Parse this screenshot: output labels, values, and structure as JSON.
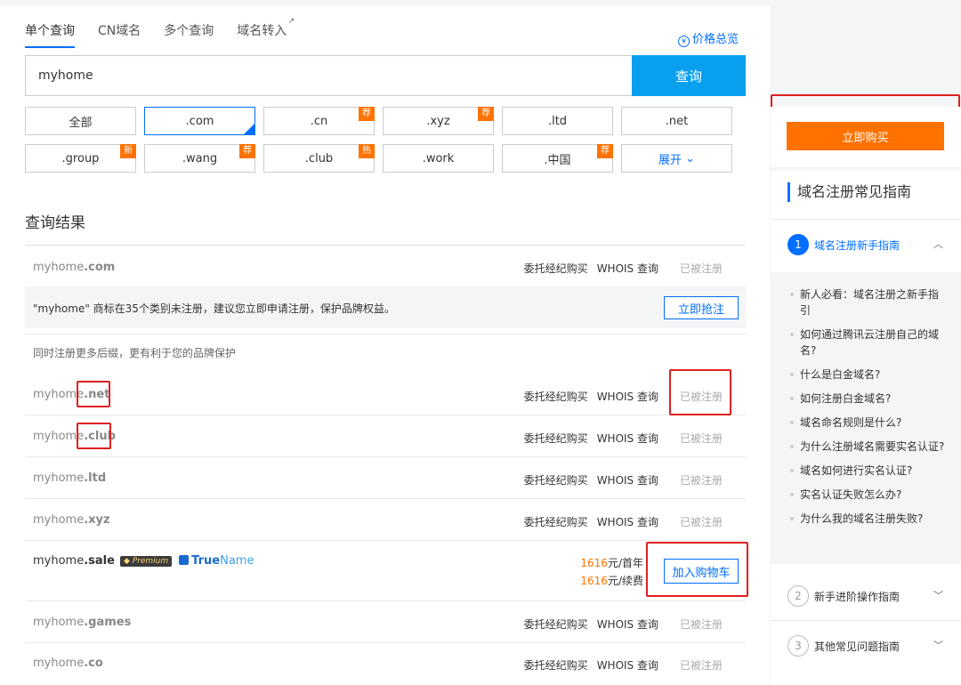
{
  "tabs": [
    {
      "label": "单个查询",
      "active": true
    },
    {
      "label": "CN域名",
      "active": false
    },
    {
      "label": "多个查询",
      "active": false
    },
    {
      "label": "域名转入",
      "active": false
    }
  ],
  "price_overview": "价格总览",
  "search": {
    "value": "myhome",
    "button": "查询"
  },
  "tlds": [
    {
      "label": "全部",
      "badge": ""
    },
    {
      "label": ".com",
      "badge": ""
    },
    {
      "label": ".cn",
      "badge": "荐"
    },
    {
      "label": ".xyz",
      "badge": "荐"
    },
    {
      "label": ".ltd",
      "badge": ""
    },
    {
      "label": ".net",
      "badge": ""
    },
    {
      "label": ".group",
      "badge": "新"
    },
    {
      "label": ".wang",
      "badge": "荐"
    },
    {
      "label": ".club",
      "badge": "热"
    },
    {
      "label": ".work",
      "badge": ""
    },
    {
      "label": ".中国",
      "badge": "荐"
    },
    {
      "label": "展开",
      "badge": ""
    }
  ],
  "results_title": "查询结果",
  "actions": {
    "broker": "委托经纪购买",
    "whois": "WHOIS 查询"
  },
  "registered": "已被注册",
  "primary_result": {
    "name": "myhome",
    "tld": ".com"
  },
  "trademark": {
    "text": "\"myhome\" 商标在35个类别未注册，建议您立即申请注册，保护品牌权益。",
    "button": "立即抢注"
  },
  "more_hint": "同时注册更多后缀，更有利于您的品牌保护",
  "results": [
    {
      "name": "myhome",
      "tld": ".net"
    },
    {
      "name": "myhome",
      "tld": ".club"
    },
    {
      "name": "myhome",
      "tld": ".ltd"
    },
    {
      "name": "myhome",
      "tld": ".xyz"
    }
  ],
  "premium": {
    "name": "myhome",
    "tld": ".sale",
    "tag": "Premium",
    "brand_a": "True",
    "brand_b": "Name",
    "price1": "1616",
    "unit1": "元/首年",
    "price2": "1616",
    "unit2": "元/续费",
    "button": "加入购物车"
  },
  "results_after": [
    {
      "name": "myhome",
      "tld": ".games"
    },
    {
      "name": "myhome",
      "tld": ".co"
    }
  ],
  "sidebar": {
    "buy_button": "立即购买",
    "guide_title": "域名注册常见指南",
    "sections": [
      {
        "num": "1",
        "label": "域名注册新手指南"
      },
      {
        "num": "2",
        "label": "新手进阶操作指南"
      },
      {
        "num": "3",
        "label": "其他常见问题指南"
      }
    ],
    "faq": [
      "新人必看：域名注册之新手指引",
      "如何通过腾讯云注册自己的域名?",
      "什么是白金域名?",
      "如何注册白金域名?",
      "域名命名规则是什么?",
      "为什么注册域名需要实名认证?",
      "域名如何进行实名认证?",
      "实名认证失败怎么办?",
      "为什么我的域名注册失败?"
    ]
  }
}
